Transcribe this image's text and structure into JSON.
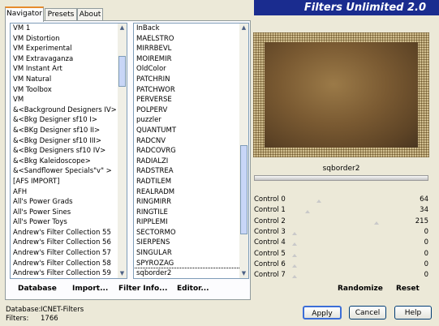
{
  "tabs": [
    {
      "label": "Navigator",
      "active": true
    },
    {
      "label": "Presets",
      "active": false
    },
    {
      "label": "About",
      "active": false
    }
  ],
  "banner_title": "Filters Unlimited 2.0",
  "categories": [
    "VM 1",
    "VM Distortion",
    "VM Experimental",
    "VM Extravaganza",
    "VM Instant Art",
    "VM Natural",
    "VM Toolbox",
    "VM",
    "&<Background Designers IV>",
    "&<Bkg Designer sf10 I>",
    "&<BKg Designer sf10 II>",
    "&<Bkg Designer sf10 III>",
    "&<Bkg Designers sf10 IV>",
    "&<Bkg Kaleidoscope>",
    "&<Sandflower Specials\"v\" >",
    "[AFS IMPORT]",
    "AFH",
    "All's Power Grads",
    "All's Power Sines",
    "All's Power Toys",
    "Andrew's Filter Collection 55",
    "Andrew's Filter Collection 56",
    "Andrew's Filter Collection 57",
    "Andrew's Filter Collection 58",
    "Andrew's Filter Collection 59",
    "Andrew's Filter Collection 60"
  ],
  "filters": [
    "InBack",
    "MAELSTRO",
    "MIRRBEVL",
    "MOIREMIR",
    "OldColor",
    "PATCHRIN",
    "PATCHWOR",
    "PERVERSE",
    "POLPERV",
    "puzzler",
    "QUANTUMT",
    "RADCNV",
    "RADCOVRG",
    "RADIALZI",
    "RADSTREA",
    "RADTILEM",
    "REALRADM",
    "RINGMIRR",
    "RINGTILE",
    "RIPPLEMI",
    "SECTORMO",
    "SIERPENS",
    "SINGULAR",
    "SPYROZAG",
    "sqborder2",
    "SQRBORDER"
  ],
  "selected_filter": "sqborder2",
  "filter_name": "sqborder2",
  "controls": [
    {
      "label": "Control 0",
      "value": "64",
      "level": 0.25
    },
    {
      "label": "Control 1",
      "value": "34",
      "level": 0.13
    },
    {
      "label": "Control 2",
      "value": "215",
      "level": 0.84
    },
    {
      "label": "Control 3",
      "value": "0",
      "level": 0
    },
    {
      "label": "Control 4",
      "value": "0",
      "level": 0
    },
    {
      "label": "Control 5",
      "value": "0",
      "level": 0
    },
    {
      "label": "Control 6",
      "value": "0",
      "level": 0
    },
    {
      "label": "Control 7",
      "value": "0",
      "level": 0
    }
  ],
  "toolbar": {
    "database": "Database",
    "import": "Import...",
    "filter_info": "Filter Info...",
    "editor": "Editor...",
    "randomize": "Randomize",
    "reset": "Reset"
  },
  "status": {
    "database_label": "Database:",
    "database_value": "ICNET-Filters",
    "filters_label": "Filters:",
    "filters_value": "1766"
  },
  "buttons": {
    "apply": "Apply",
    "cancel": "Cancel",
    "help": "Help"
  },
  "colors": {
    "banner": "#1a2c8f",
    "preview_border": "#d9ceb0",
    "preview_center": "#7a5a32"
  }
}
